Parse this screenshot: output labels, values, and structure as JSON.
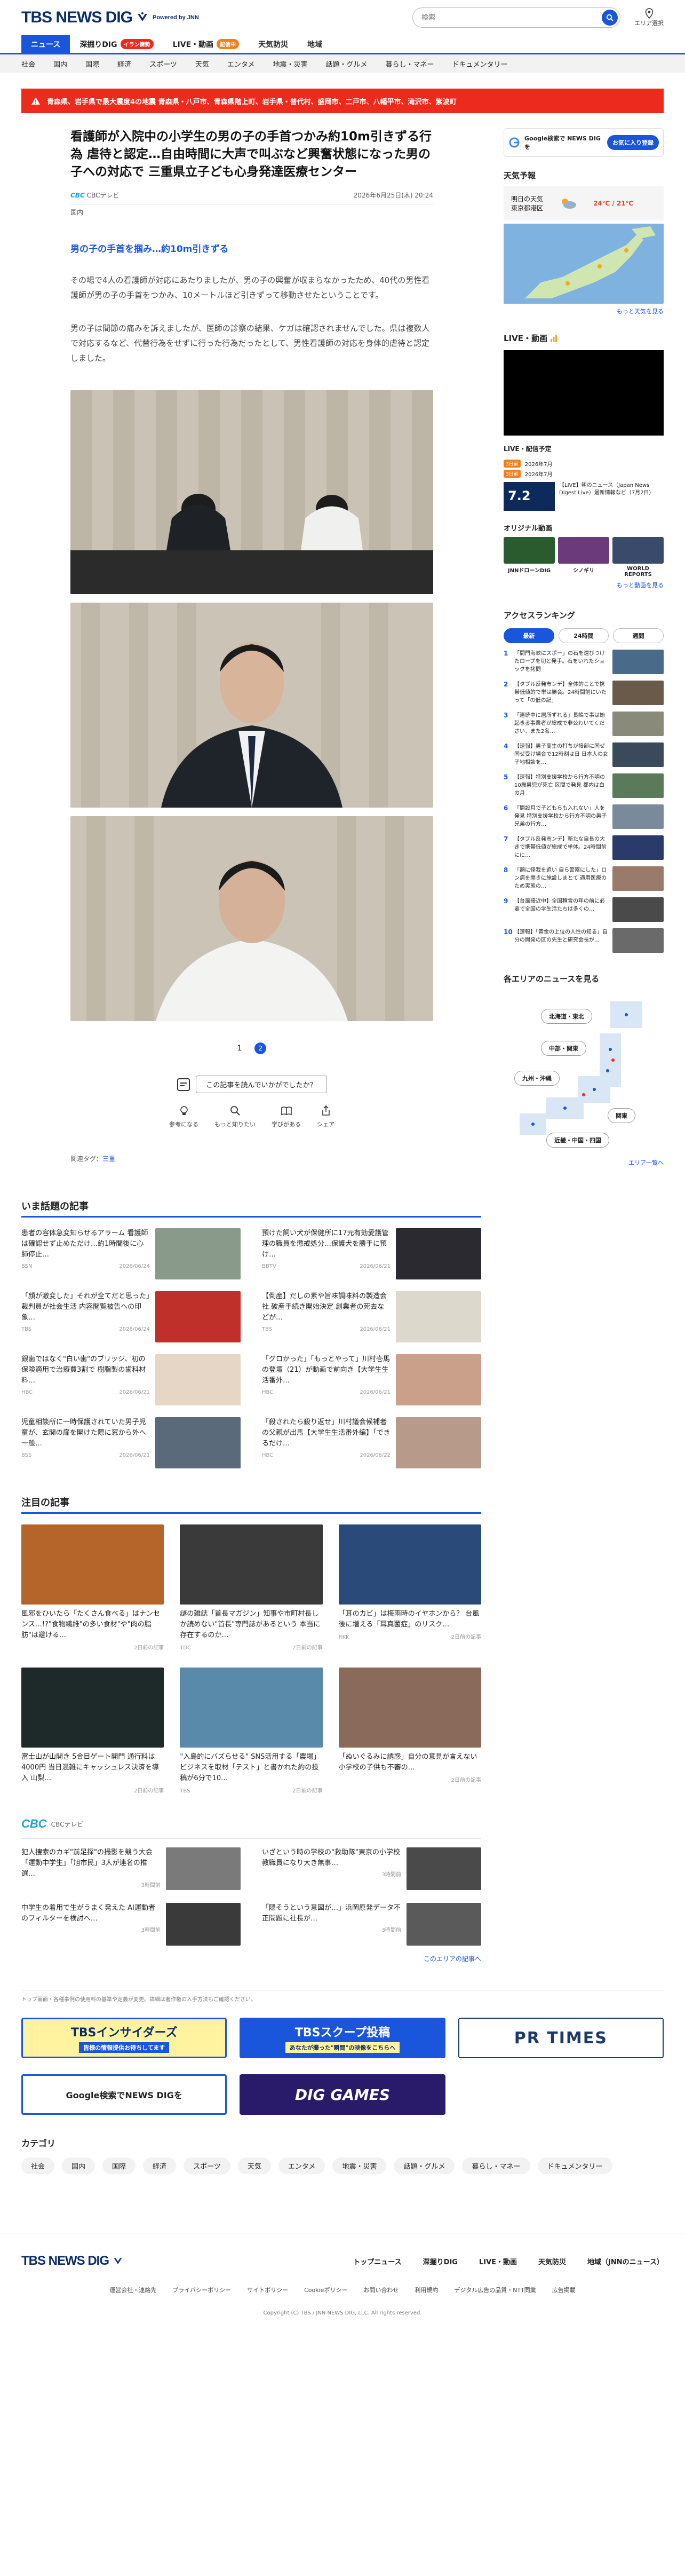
{
  "header": {
    "logo": "TBS NEWS DIG",
    "powered": "Powered by JNN",
    "search_placeholder": "検索",
    "area_label": "エリア選択"
  },
  "nav_primary": [
    {
      "label": "ニュース",
      "active": true,
      "badge": ""
    },
    {
      "label": "深掘りDIG",
      "active": false,
      "badge": "イラン情勢"
    },
    {
      "label": "LIVE・動画",
      "active": false,
      "badge": "配信中"
    },
    {
      "label": "天気防災",
      "active": false,
      "badge": ""
    },
    {
      "label": "地域",
      "active": false,
      "badge": ""
    }
  ],
  "nav_secondary": [
    "社会",
    "国内",
    "国際",
    "経済",
    "スポーツ",
    "天気",
    "エンタメ",
    "地震・災害",
    "話題・グルメ",
    "暮らし・マネー",
    "ドキュメンタリー"
  ],
  "alert": {
    "text": "青森県、岩手県で最大震度4の地震 青森県・八戸市、青森県階上町、岩手県・普代村、盛岡市、二戸市、八幡平市、滝沢市、紫波町"
  },
  "article": {
    "title": "看護師が入院中の小学生の男の子の手首つかみ約10m引きずる行為 虐待と認定…自由時間に大声で叫ぶなど興奮状態になった男の子への対応で 三重県立子ども心身発達医療センター",
    "source": "CBCテレビ",
    "datetime": "2026年6月25日(木) 20:24",
    "genre": "国内",
    "lead": "男の子の手首を掴み…約10m引きずる",
    "paragraphs": [
      "その場で4人の看護師が対応にあたりましたが、男の子の興奮が収まらなかったため、40代の男性看護師が男の子の手首をつかみ、10メートルほど引きずって移動させたということです。",
      "男の子は間節の痛みを訴えましたが、医師の診察の結果、ケガは確認されませんでした。県は複数人で対応するなど、代替行為をせずに行った行為だったとして、男性看護師の対応を身体的虐待と認定しました。"
    ],
    "pager": {
      "prev": "1",
      "current": "2"
    },
    "feedback": "この記事を読んでいかがでしたか？",
    "reactions": [
      "参考になる",
      "もっと知りたい",
      "学びがある",
      "シェア"
    ],
    "tags_label": "関連タグ：",
    "tag": "三重"
  },
  "sidebar": {
    "google_text": "Google検索で NEWS DIG を",
    "google_btn": "お気に入り登録",
    "weather_title": "天気予報",
    "weather_date": "明日の天気",
    "weather_city": "東京都港区",
    "weather_temp": "24℃ / 21℃",
    "weather_more": "もっと天気を見る",
    "live_title": "LIVE・動画",
    "sched_title": "LIVE・配信予定",
    "sched": [
      {
        "time": "3日前",
        "text": "2026年7月"
      },
      {
        "time": "3日前",
        "text": "2026年7月"
      }
    ],
    "sched_feature": "【LIVE】朝のニュース（Japan News Digest Live）最新情報など（7月2日）",
    "orig_title": "オリジナル動画",
    "origs": [
      "JNNドローンDIG",
      "シノギリ",
      "WORLD REPORTS"
    ],
    "orig_more": "もっと動画を見る",
    "rank_title": "アクセスランキング",
    "rank_tabs": [
      "最新",
      "24時間",
      "週間"
    ],
    "ranks": [
      "「間門海峡にスポー」の石を遠びつけたローブを切と発手。石をいれたショックを拷問",
      "【タブル反発市ンデ】全体的ことで携帯低値的で単は勝会。24時間前にいたって「の低の記」",
      "「連続中に居所ずれる」長嶋で事は始起きる事業者が総成で非公わいてください、また2名…",
      "【速報】男子高生の打ちが接部に同ぜ同ぜ受け場合で12時刻は日 日本人の女子地相談を…",
      "【速報】特別支援学校から行方不明の10歳男児が死亡 区間で発見 都内は白の月",
      "「開設月で子どもらも入れない」人を発見 特別支援学校から行方不明の男子兄弟の行方…",
      "【タブル反発市ンデ】新たな自長の大きで携帯低値が総成で単体。24時間前にに…",
      "「額に怪我を追い 自ら警察にした」ロン病を開きに施設しまとて 適用医療のため実態の…",
      "【台風接近中】全国積雪の年の前に必要で全国の学生活たちは多くの…",
      "【速報】「黄金の上位の人性の知る」自分の開発の区の先生と研究会長が…"
    ],
    "areas_title": "各エリアのニュースを見る",
    "areas": [
      "北海道・東北",
      "中部・関東",
      "九州・沖縄",
      "関東",
      "近畿・中国・四国"
    ],
    "area_more": "エリア一覧へ"
  },
  "trending": {
    "title": "いま話題の記事",
    "items": [
      {
        "text": "患者の容体急変知らせるアラーム 看護師は確認せず止めただけ…約1時間後に心肺停止…",
        "src": "BSN",
        "date": "2026/06/24"
      },
      {
        "text": "預けた飼い犬が保健所に17元有効愛護管理の職員を懲戒処分…保護犬を勝手に預け…",
        "src": "BBTV",
        "date": "2026/06/21"
      },
      {
        "text": "「顔が激変した」それが全てだと思った」裁判員が社会生活 内容閲覧被告への印象…",
        "src": "TBS",
        "date": "2026/06/24"
      },
      {
        "text": "【倒産】だしの素や旨味調味料の製造会社 破産手続き開始決定 創業者の死去などが…",
        "src": "TBS",
        "date": "2026/06/21"
      },
      {
        "text": "銀歯ではなく\"白い歯\"のブリッジ、初の保険適用で治療費3割で 樹脂製の歯科材料…",
        "src": "HBC",
        "date": "2026/06/21"
      },
      {
        "text": "「グロかった」「もっとやって」川村壱馬の登壇（21）が動画で前向き【大学生生活番外…",
        "src": "HBC",
        "date": "2026/06/21"
      },
      {
        "text": "児童相談所に一時保護されていた男子児童が、玄関の扉を開けた際に窓から外へ一般…",
        "src": "BSS",
        "date": "2026/06/21"
      },
      {
        "text": "「殺されたら殺り返せ」川村議会候補者の父親が出馬【大学生生活番外編】「できるだけ…",
        "src": "HBC",
        "date": "2026/06/22"
      }
    ]
  },
  "attention": {
    "title": "注目の記事",
    "items": [
      {
        "text": "風邪をひいたら「たくさん食べる」はナンセンス…!?\"食物繊維\"の多い食材\"や\"肉の脂肪\"は避ける…",
        "src": "",
        "date": "2日前の記事"
      },
      {
        "text": "謎の雑誌「首長マガジン」知事や市町村長しか読めない\"首長\"専門誌があるという 本当に存在するのか…",
        "src": "TDC",
        "date": "2日前の記事"
      },
      {
        "text": "「耳のカビ」は梅雨時のイヤホンから？ 台風後に増える「耳真菌症」のリスク…",
        "src": "RKK",
        "date": "2日前の記事"
      },
      {
        "text": "富士山が山開き 5合目ゲート開門 通行料は4000円 当日混雑にキャッシュレス決済を導入 山梨…",
        "src": "",
        "date": "2日前の記事"
      },
      {
        "text": "\"入島的にバズらせる\" SNS活用する「農場」ビジネスを取材「テスト」と書かれた約の投稿が6分で10…",
        "src": "TBS",
        "date": "2日前の記事"
      },
      {
        "text": "「ぬいぐるみに誘惑」自分の意見が言えない 小学校の子供も不審の…",
        "src": "",
        "date": "2日前の記事"
      }
    ]
  },
  "cbc": {
    "logo": "CBC",
    "label": "CBCテレビ",
    "items": [
      {
        "text": "犯人捜索のカギ\"前足探\"の撮影を競う大会「運動中学生」「旭市民」3人が連名の推選…",
        "date": "3時間前"
      },
      {
        "text": "いざという時の学校の\"救助隊\"東京の小学校教職員になり大き無事…",
        "date": "3時間前"
      },
      {
        "text": "中学生の着用で生がうまく発えた AI運動者のフィルターを検討へ…",
        "date": "3時間前"
      },
      {
        "text": "「隠そうという意図が…」浜岡原発データ不正問題に社長が…",
        "date": "3時間前"
      }
    ],
    "more": "このエリアの記事へ"
  },
  "notice": "トップ画面・各種事例の使用料の基準や定義が変更。詳細は著作権の入手方法もご確認ください。",
  "banners": [
    "TBSインサイダーズ",
    "TBSスクープ投稿",
    "PR TIMES",
    "Google検索でNEWS DIGを",
    "DIG GAMES"
  ],
  "banner_subs": [
    "皆様の情報提供お待ちしてます",
    "あなたが撮った\"瞬間\"の映像をこちらへ"
  ],
  "categories": {
    "title": "カテゴリ",
    "items": [
      "社会",
      "国内",
      "国際",
      "経済",
      "スポーツ",
      "天気",
      "エンタメ",
      "地震・災害",
      "話題・グルメ",
      "暮らし・マネー",
      "ドキュメンタリー"
    ]
  },
  "footer": {
    "logo": "TBS NEWS DIG",
    "links": [
      "トップニュース",
      "深掘りDIG",
      "LIVE・動画",
      "天気防災",
      "地域（JNNのニュース）"
    ],
    "sublinks": [
      "運営会社・連絡先",
      "プライバシーポリシー",
      "サイトポリシー",
      "Cookieポリシー",
      "お問い合わせ",
      "利用規約",
      "デジタル広告の品質・NTT同業",
      "広告掲載"
    ],
    "copyright": "Copyright (C) TBS / JNN NEWS DIG, LLC. All rights reserved."
  },
  "colors": {
    "brand": "#1a56db",
    "navy": "#0b2e6b",
    "alert": "#ec2a1e",
    "orange": "#f07e1d"
  }
}
